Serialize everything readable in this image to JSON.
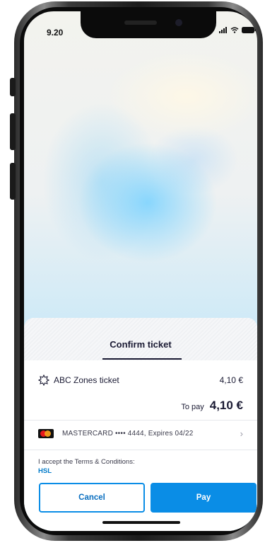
{
  "status_bar": {
    "time": "9.20"
  },
  "sheet": {
    "title": "Confirm ticket",
    "ticket": {
      "name": "ABC Zones ticket",
      "price": "4,10 €"
    },
    "total": {
      "label": "To pay",
      "amount": "4,10 €"
    },
    "payment_method": {
      "text": "MASTERCARD •••• 4444, Expires 04/22"
    },
    "terms": {
      "text": "I accept the Terms & Conditions:",
      "link": "HSL"
    },
    "buttons": {
      "cancel": "Cancel",
      "pay": "Pay"
    }
  },
  "colors": {
    "accent": "#0a8de6",
    "link": "#007ac9",
    "text_dark": "#1a1a33"
  },
  "icons": {
    "ticket": "zone-ticket-icon",
    "card": "mastercard-logo-icon",
    "chevron": "chevron-right-icon"
  }
}
